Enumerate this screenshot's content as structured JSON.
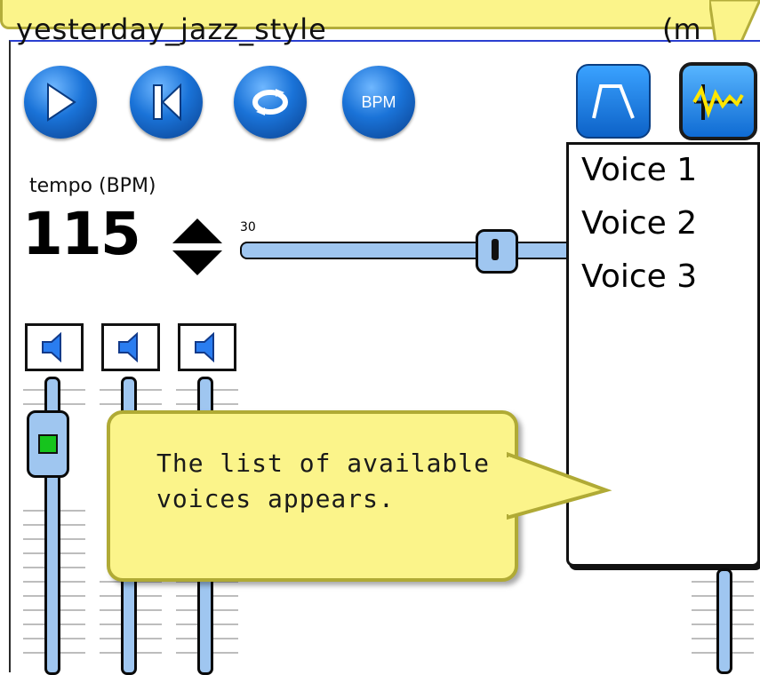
{
  "window": {
    "title": "yesterday_jazz_style",
    "title_right": "(m"
  },
  "toolbar": {
    "play_icon": "play-icon",
    "rewind_icon": "rewind-to-start-icon",
    "loop_icon": "loop-icon",
    "bpm_label": "BPM",
    "envelope_icon": "envelope-icon",
    "voice_icon": "waveform-icon"
  },
  "tempo": {
    "label": "tempo (BPM)",
    "value": "115",
    "min_label": "30"
  },
  "voice_list": {
    "items": [
      "Voice 1",
      "Voice 2",
      "Voice 3"
    ]
  },
  "callout": {
    "line1": "The list of available",
    "line2": "voices appears."
  },
  "colors": {
    "accent_blue": "#1a73d8",
    "track_blue": "#9fc6f0",
    "callout_yellow": "#fbf48a",
    "led_green": "#16c41d"
  }
}
